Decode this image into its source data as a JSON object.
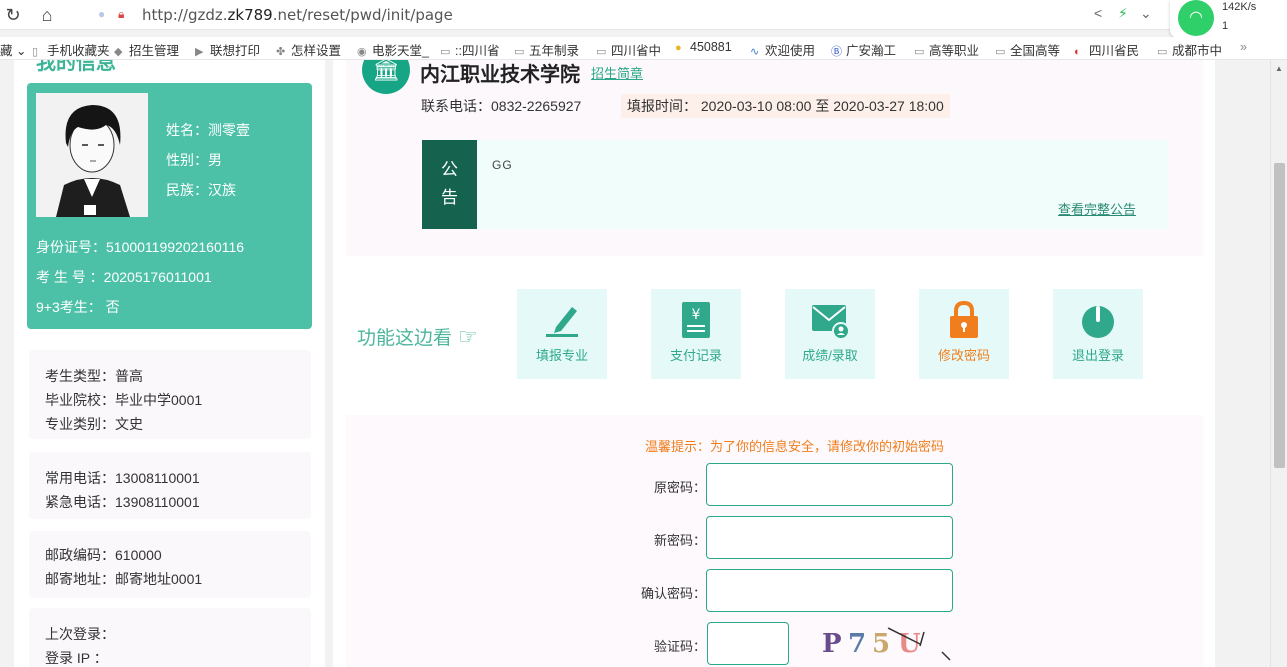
{
  "browser": {
    "url_prefix": "http://gzdz.",
    "url_host": "zk789",
    "url_suffix": ".net/reset/pwd/init/page",
    "net_speed": "142K/s",
    "net_count": "1",
    "bookmarks": [
      {
        "label": "藏 ⌄",
        "icon": ""
      },
      {
        "label": "手机收藏夹",
        "icon": "phone-icon"
      },
      {
        "label": "招生管理",
        "icon": "cube-icon"
      },
      {
        "label": "联想打印",
        "icon": "play-icon"
      },
      {
        "label": "怎样设置",
        "icon": "paw-icon"
      },
      {
        "label": "电影天堂_",
        "icon": "shield-icon"
      },
      {
        "label": "::四川省",
        "icon": "page-icon"
      },
      {
        "label": "五年制录",
        "icon": "page-icon"
      },
      {
        "label": "四川省中",
        "icon": "page-icon"
      },
      {
        "label": "450881",
        "icon": "coin-icon"
      },
      {
        "label": "欢迎使用",
        "icon": "wave-icon"
      },
      {
        "label": "广安瀚工",
        "icon": "b-icon"
      },
      {
        "label": "高等职业",
        "icon": "page-icon"
      },
      {
        "label": "全国高等",
        "icon": "page-icon"
      },
      {
        "label": "四川省民",
        "icon": "circle-icon"
      },
      {
        "label": "成都市中",
        "icon": "page-icon"
      }
    ]
  },
  "profile": {
    "heading": "我的信息",
    "name": "姓名：测零壹",
    "gender": "性别：男",
    "ethnicity": "民族：汉族",
    "id_card": "身份证号：510001199202160116",
    "exam_no": "考 生 号 ：20205176011001",
    "nine_three": "9+3考生： 否"
  },
  "info": {
    "exam_type": "考生类型：普高",
    "school": "毕业院校：毕业中学0001",
    "major_type": "专业类别：文史",
    "phone": "常用电话：13008110001",
    "emergency": "紧急电话：13908110001",
    "postcode": "邮政编码：610000",
    "address": "邮寄地址：邮寄地址0001",
    "last_login": "上次登录：",
    "login_ip": " 登录 IP ："
  },
  "school": {
    "name": "内江职业技术学院",
    "brochure": "招生简章",
    "phone": "联系电话：0832-2265927",
    "fill_time": "填报时间： 2020-03-10 08:00 至 2020-03-27 18:00"
  },
  "notice": {
    "tag_line1": "公",
    "tag_line2": "告",
    "content": "GG",
    "more": "查看完整公告"
  },
  "functions": {
    "title": "功能这边看",
    "items": [
      {
        "label": "填报专业",
        "icon": "pen-icon"
      },
      {
        "label": "支付记录",
        "icon": "receipt-icon"
      },
      {
        "label": "成绩/录取",
        "icon": "mail-user-icon"
      },
      {
        "label": "修改密码",
        "icon": "lock-icon"
      },
      {
        "label": "退出登录",
        "icon": "power-icon"
      }
    ]
  },
  "form": {
    "tip": "温馨提示：为了你的信息安全，请修改你的初始密码",
    "old_password": "原密码：",
    "new_password": "新密码：",
    "confirm_password": "确认密码：",
    "captcha_label": "验证码：",
    "captcha_text": "P75U"
  },
  "colors": {
    "accent": "#4dc1a7",
    "dark_green": "#15634f",
    "orange": "#f07e1d"
  }
}
